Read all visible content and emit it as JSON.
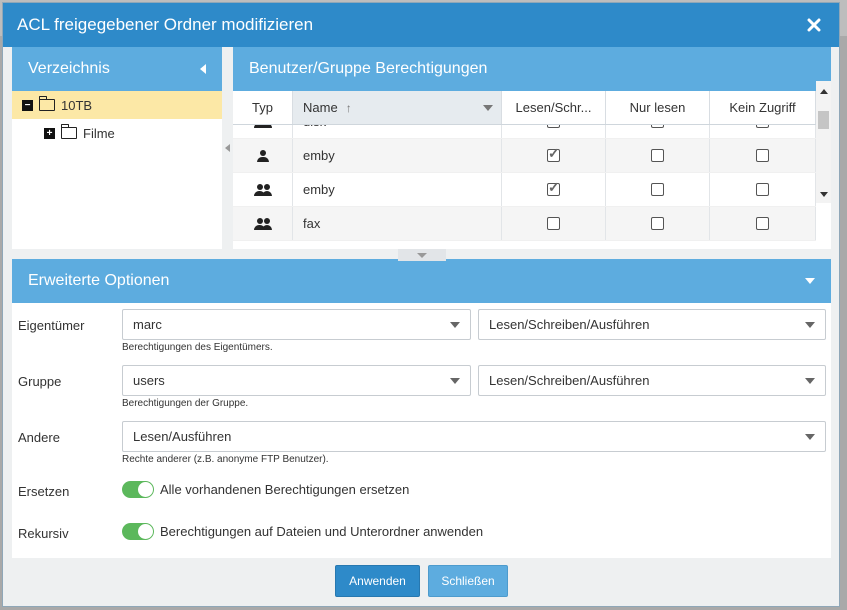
{
  "dialog": {
    "title": "ACL freigegebener Ordner modifizieren"
  },
  "tree": {
    "header": "Verzeichnis",
    "items": [
      {
        "label": "10TB",
        "toggle": "−",
        "selected": true
      },
      {
        "label": "Filme",
        "toggle": "+",
        "selected": false
      }
    ]
  },
  "perms": {
    "header": "Benutzer/Gruppe Berechtigungen",
    "columns": {
      "type": "Typ",
      "name": "Name",
      "rw": "Lesen/Schr...",
      "ro": "Nur lesen",
      "none": "Kein Zugriff"
    },
    "rows": [
      {
        "type": "group",
        "name": "disk",
        "rw": false,
        "ro": false,
        "none": false
      },
      {
        "type": "user",
        "name": "emby",
        "rw": true,
        "ro": false,
        "none": false
      },
      {
        "type": "group",
        "name": "emby",
        "rw": true,
        "ro": false,
        "none": false
      },
      {
        "type": "group",
        "name": "fax",
        "rw": false,
        "ro": false,
        "none": false
      }
    ]
  },
  "advanced": {
    "header": "Erweiterte Optionen",
    "owner": {
      "label": "Eigentümer",
      "value": "marc",
      "perm": "Lesen/Schreiben/Ausführen",
      "hint": "Berechtigungen des Eigentümers."
    },
    "group": {
      "label": "Gruppe",
      "value": "users",
      "perm": "Lesen/Schreiben/Ausführen",
      "hint": "Berechtigungen der Gruppe."
    },
    "other": {
      "label": "Andere",
      "perm": "Lesen/Ausführen",
      "hint": "Rechte anderer (z.B. anonyme FTP Benutzer)."
    },
    "replace": {
      "label": "Ersetzen",
      "text": "Alle vorhandenen Berechtigungen ersetzen",
      "on": true
    },
    "recursive": {
      "label": "Rekursiv",
      "text": "Berechtigungen auf Dateien und Unterordner anwenden",
      "on": true
    }
  },
  "buttons": {
    "apply": "Anwenden",
    "close": "Schließen"
  },
  "colors": {
    "primary": "#2e8ac9",
    "header": "#5dacdf",
    "toggle_on": "#5cb85c",
    "selected_row": "#fce8a6"
  }
}
